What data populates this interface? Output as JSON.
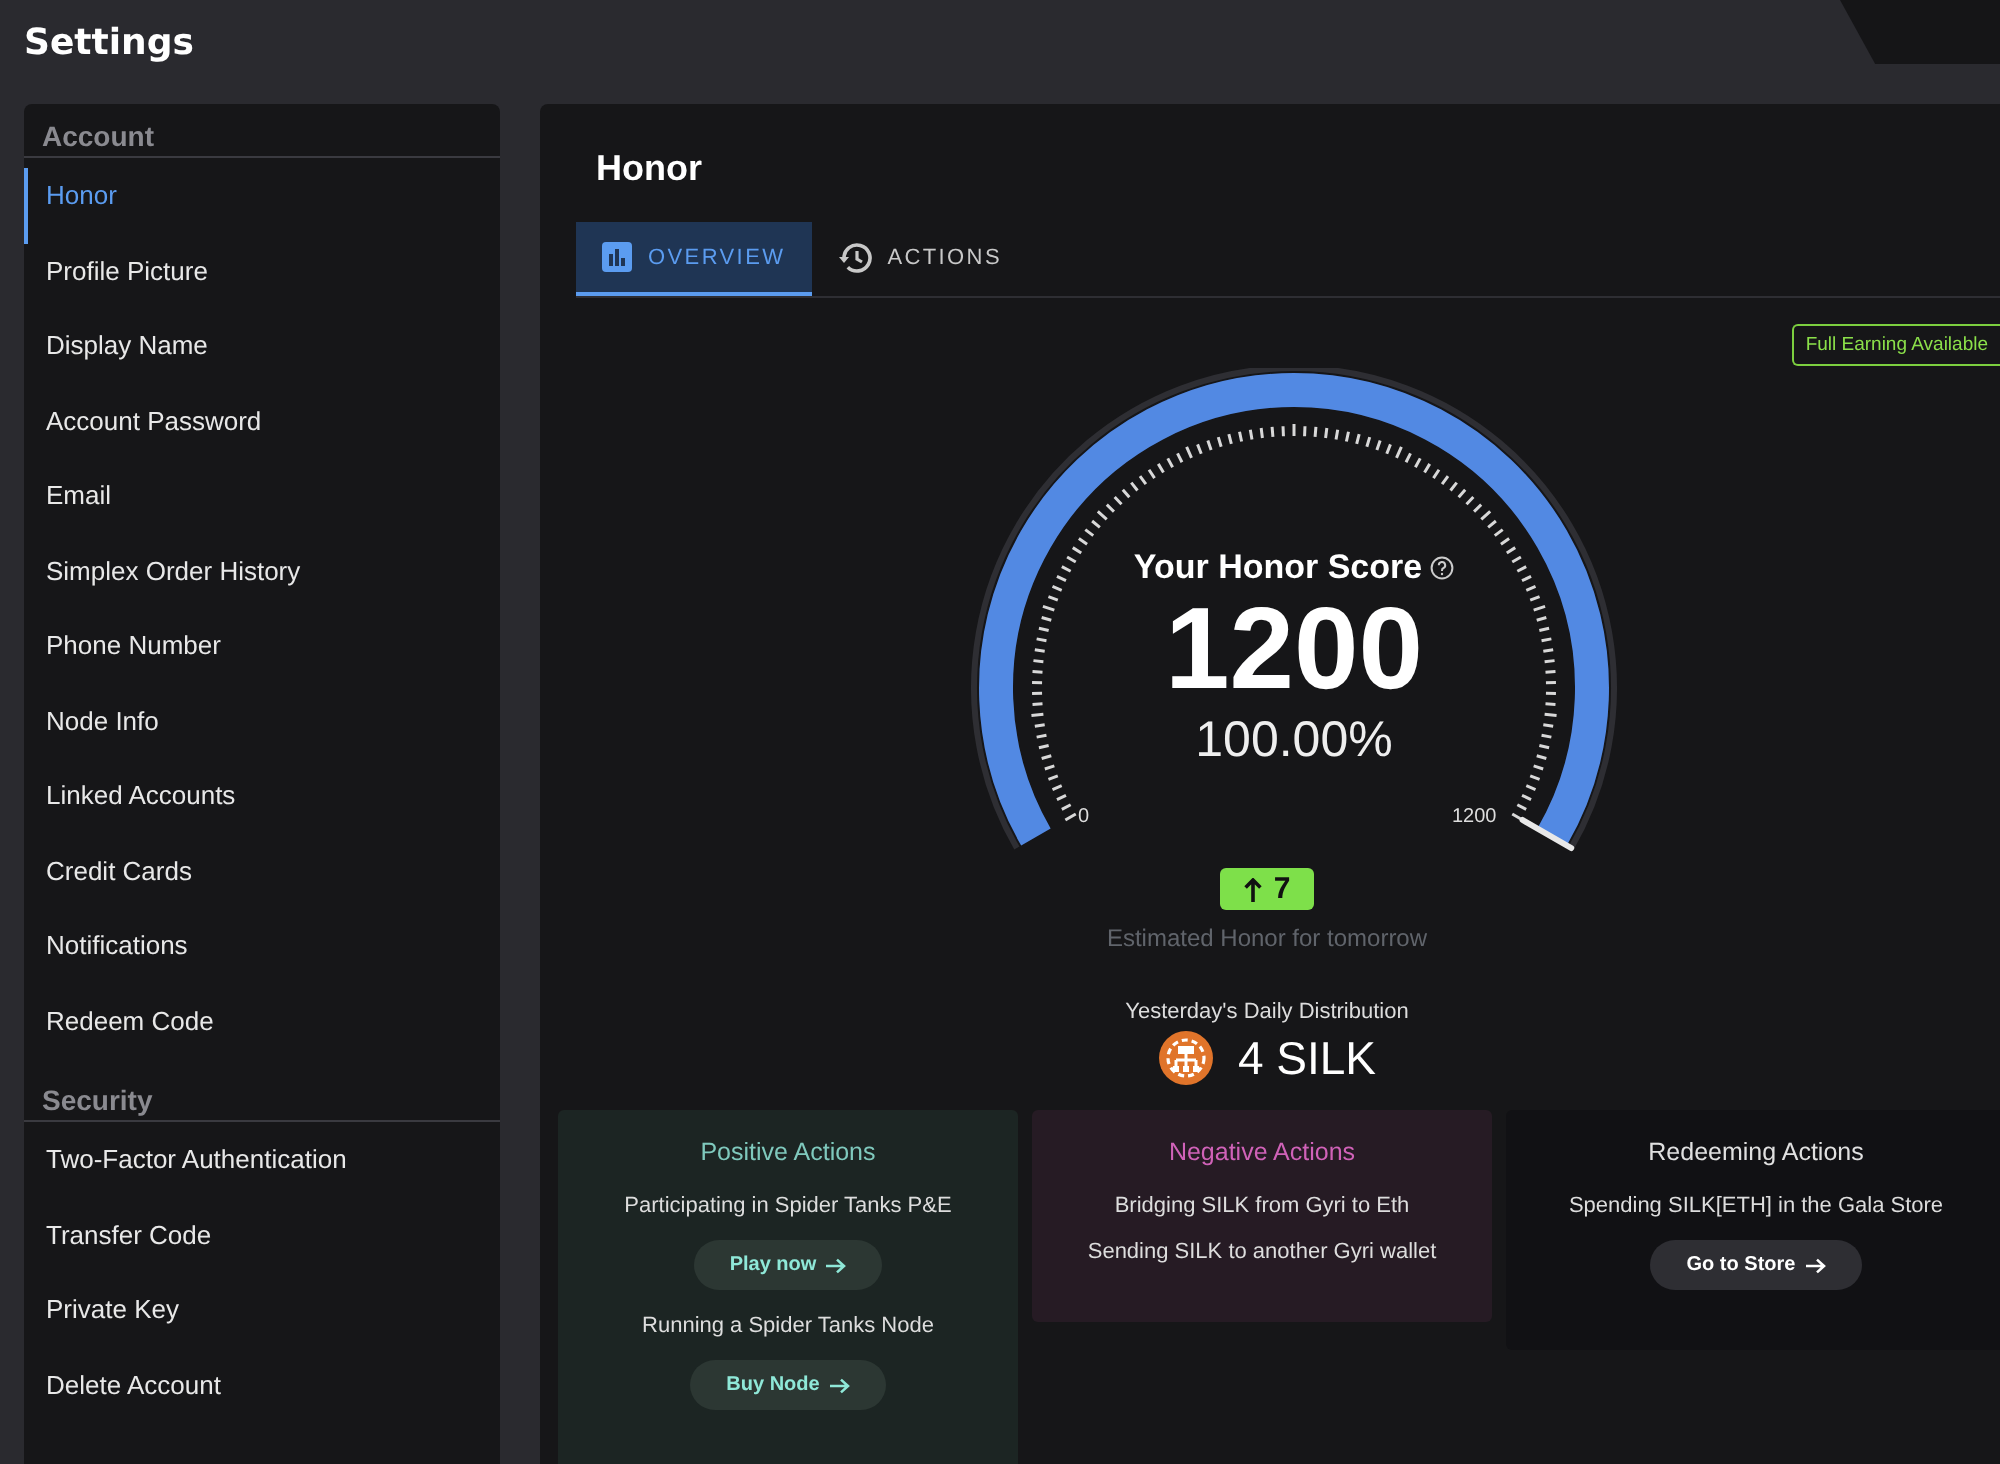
{
  "header": {
    "title": "Settings"
  },
  "sidebar": {
    "sections": [
      {
        "heading": "Account",
        "items": [
          {
            "label": "Honor",
            "selected": true
          },
          {
            "label": "Profile Picture",
            "selected": false
          },
          {
            "label": "Display Name",
            "selected": false
          },
          {
            "label": "Account Password",
            "selected": false
          },
          {
            "label": "Email",
            "selected": false
          },
          {
            "label": "Simplex Order History",
            "selected": false
          },
          {
            "label": "Phone Number",
            "selected": false
          },
          {
            "label": "Node Info",
            "selected": false
          },
          {
            "label": "Linked Accounts",
            "selected": false
          },
          {
            "label": "Credit Cards",
            "selected": false
          },
          {
            "label": "Notifications",
            "selected": false
          },
          {
            "label": "Redeem Code",
            "selected": false
          }
        ]
      },
      {
        "heading": "Security",
        "items": [
          {
            "label": "Two-Factor Authentication",
            "selected": false
          },
          {
            "label": "Transfer Code",
            "selected": false
          },
          {
            "label": "Private Key",
            "selected": false
          },
          {
            "label": "Delete Account",
            "selected": false
          }
        ]
      }
    ]
  },
  "main": {
    "title": "Honor",
    "tabs": [
      {
        "label": "OVERVIEW",
        "kind": "chart",
        "selected": true
      },
      {
        "label": "ACTIONS",
        "kind": "history",
        "selected": false
      }
    ],
    "badge": "Full Earning Available",
    "gauge": {
      "title": "Your Honor Score",
      "score": "1200",
      "percent": "100.00%",
      "min_label": "0",
      "max_label": "1200",
      "level": 1.0
    },
    "estimate": {
      "value": "7",
      "label": "Estimated Honor for tomorrow"
    },
    "distribution": {
      "label": "Yesterday's Daily Distribution",
      "amount": "4 SILK"
    },
    "cards": [
      {
        "kind": "positive",
        "title": "Positive Actions",
        "entries": [
          {
            "text": "Participating in Spider Tanks P&E",
            "button": "Play now"
          },
          {
            "text": "Running a Spider Tanks Node",
            "button": "Buy Node"
          }
        ]
      },
      {
        "kind": "negative",
        "title": "Negative Actions",
        "entries": [
          {
            "text": "Bridging SILK from Gyri to Eth"
          },
          {
            "text": "Sending SILK to another Gyri wallet"
          }
        ]
      },
      {
        "kind": "redeeming",
        "title": "Redeeming Actions",
        "entries": [
          {
            "text": "Spending SILK[ETH] in the Gala Store",
            "button": "Go to Store"
          }
        ]
      }
    ]
  }
}
